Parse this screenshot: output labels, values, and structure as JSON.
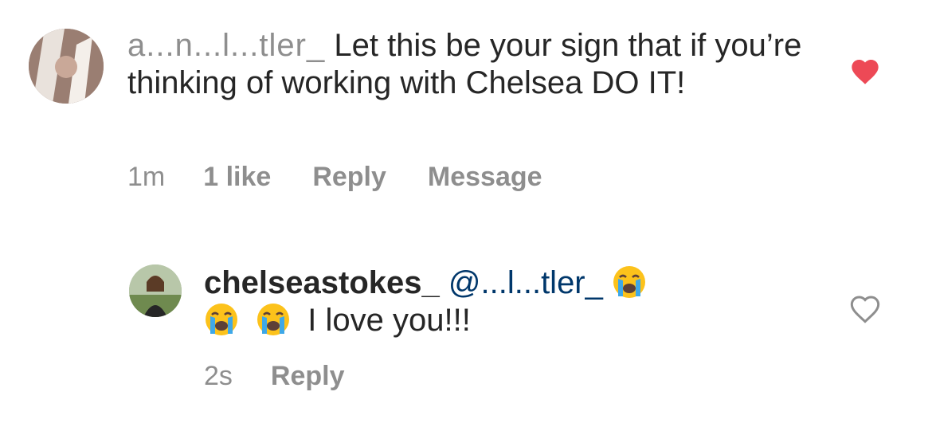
{
  "comment": {
    "username": "a...n...l...tler_",
    "text": "Let this be your sign that if you’re thinking of working with Chelsea DO IT!",
    "time": "1m",
    "likes": "1 like",
    "reply_label": "Reply",
    "message_label": "Message",
    "liked": true,
    "heart_color": "#ed4956"
  },
  "reply": {
    "username": "chelseastokes_",
    "mention": "@...l...tler_",
    "emoji": [
      "crying-face",
      "crying-face",
      "crying-face"
    ],
    "text": "I love you!!!",
    "time": "2s",
    "reply_label": "Reply",
    "liked": false,
    "heart_color": "#8e8e8e"
  }
}
